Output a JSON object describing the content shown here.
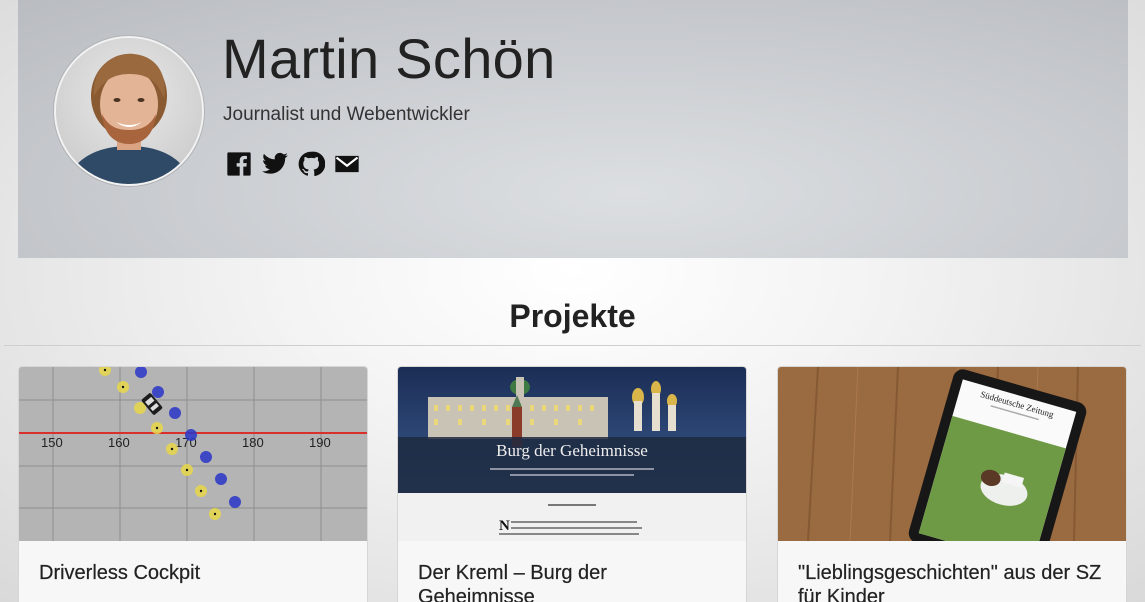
{
  "profile": {
    "name": "Martin Schön",
    "subtitle": "Journalist und Webentwickler",
    "social": [
      {
        "icon": "facebook-icon"
      },
      {
        "icon": "twitter-icon"
      },
      {
        "icon": "github-icon"
      },
      {
        "icon": "mail-icon"
      }
    ]
  },
  "projects": {
    "heading": "Projekte",
    "items": [
      {
        "title": "Driverless Cockpit",
        "thumb_labels": [
          "150",
          "160",
          "170",
          "180",
          "190"
        ]
      },
      {
        "title": "Der Kreml – Burg der Geheimnisse",
        "thumb_title": "Burg der Geheimnisse"
      },
      {
        "title": "\"Lieblingsgeschichten\" aus der SZ für Kinder",
        "thumb_brand": "Süddeutsche Zeitung"
      }
    ]
  },
  "colors": {
    "accent_red": "#d9302b",
    "dot_blue": "#2a36c9",
    "dot_yellow": "#e8d84a"
  }
}
